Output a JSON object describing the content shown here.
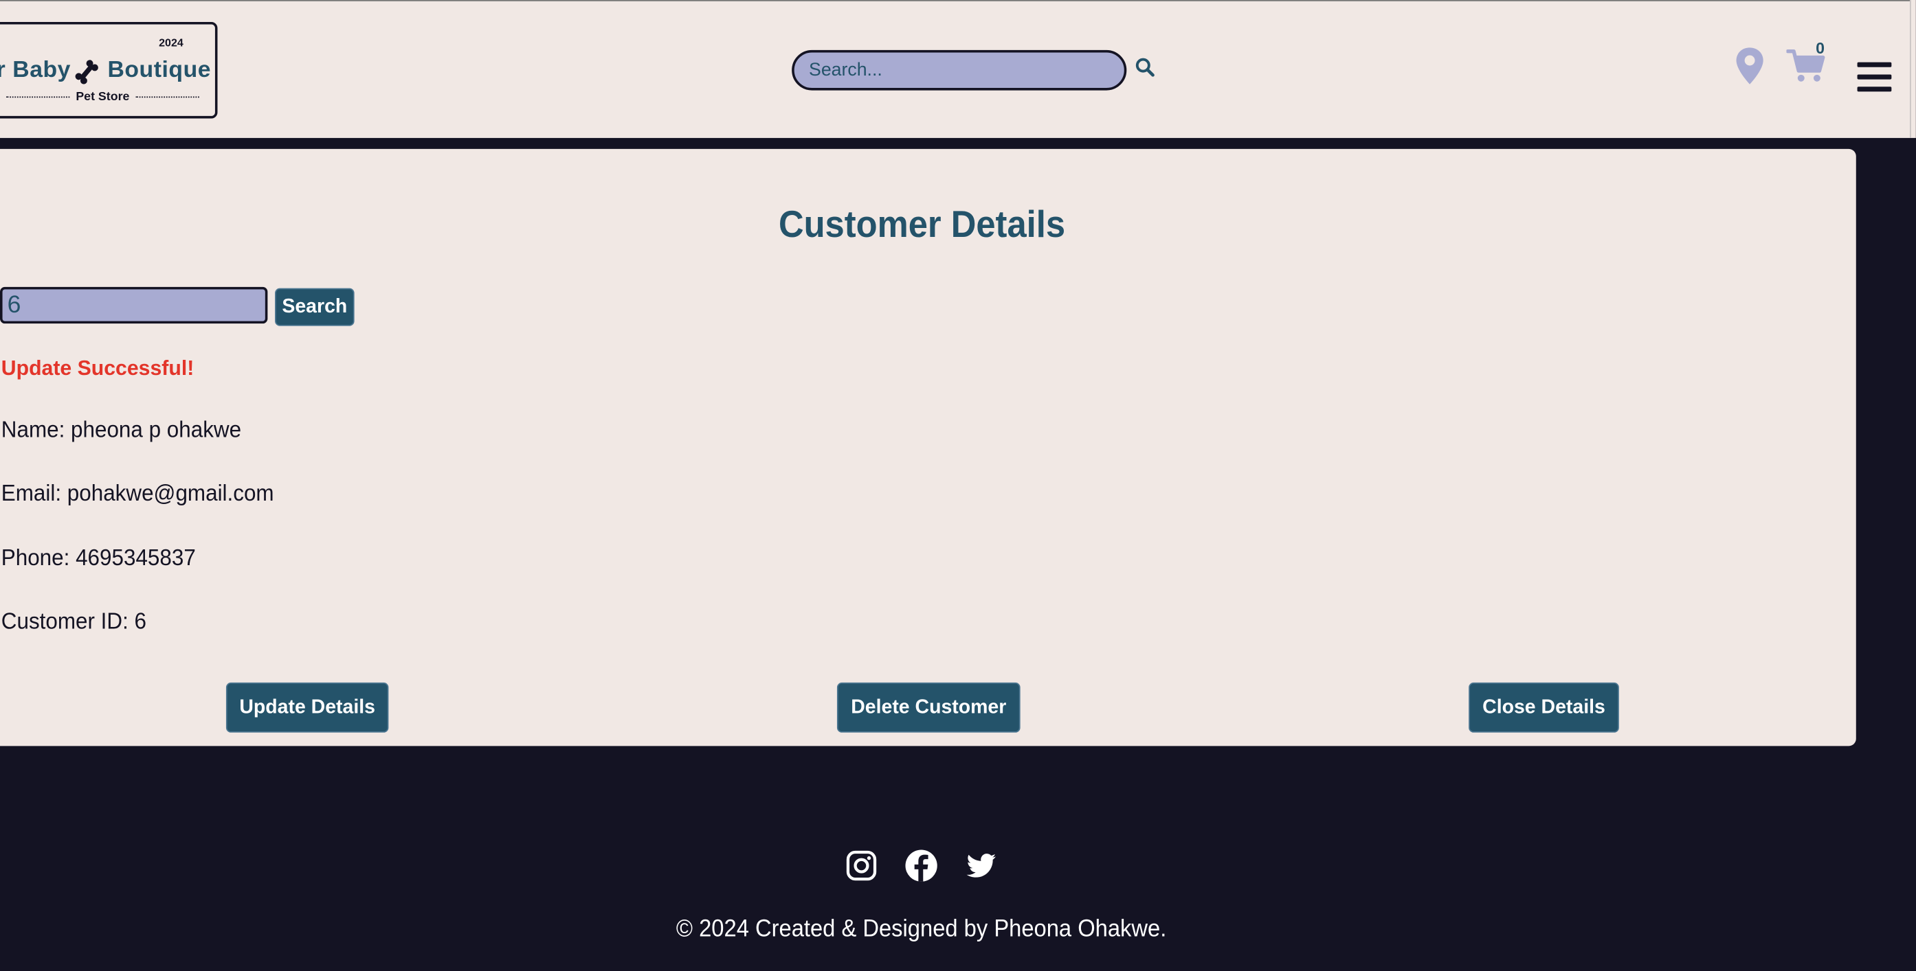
{
  "header": {
    "logo": {
      "year": "2024",
      "word_left": "r Baby",
      "word_right": "Boutique",
      "subtitle": "Pet Store"
    },
    "search": {
      "placeholder": "Search...",
      "icon": "search-icon"
    },
    "icons": {
      "location": "map-pin-icon",
      "cart": "shopping-cart-icon",
      "menu": "hamburger-menu-icon"
    },
    "cart_count": "0"
  },
  "main": {
    "title": "Customer Details",
    "search_value": "6",
    "search_button": "Search",
    "status_message": "Update Successful!",
    "fields": {
      "name": "Name: pheona p ohakwe",
      "email": "Email: pohakwe@gmail.com",
      "phone": "Phone: 4695345837",
      "customer_id": "Customer ID: 6"
    },
    "buttons": {
      "update": "Update Details",
      "delete": "Delete Customer",
      "close": "Close Details"
    }
  },
  "footer": {
    "social": [
      "instagram-icon",
      "facebook-icon",
      "twitter-icon"
    ],
    "copyright": "© 2024 Created & Designed by Pheona Ohakwe."
  },
  "colors": {
    "page_background": "#141323",
    "panel_background": "#f1e8e4",
    "primary": "#24536a",
    "input_background": "#a8abd2",
    "status_red": "#e3352a"
  }
}
